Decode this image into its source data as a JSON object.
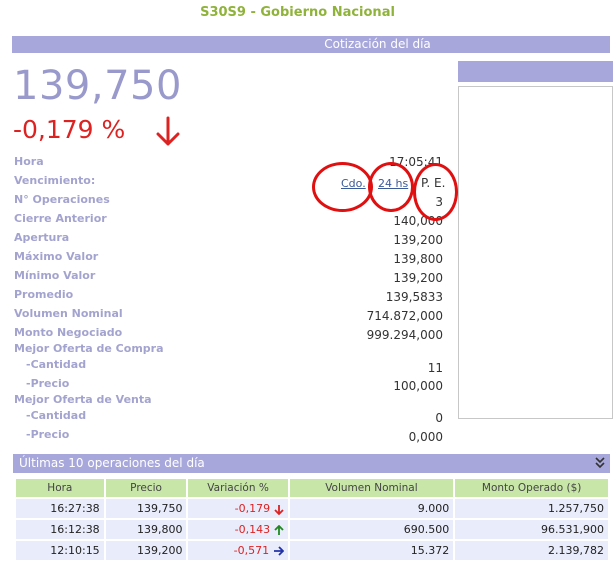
{
  "page_title": "S30S9 - Gobierno Nacional",
  "section_title": "Cotización del día",
  "price": "139,750",
  "variation": "-0,179 %",
  "colors": {
    "accent": "#a7a7db",
    "negative": "#dd2222",
    "positive": "#228822",
    "annotation": "#e01010"
  },
  "info": {
    "hora_label": "Hora",
    "hora_value": "17:05:41",
    "vencimiento_label": "Vencimiento:",
    "venc_cdo": "Cdo.",
    "venc_24": "24 hs",
    "venc_pe": "P. E.",
    "operaciones_label": "N° Operaciones",
    "operaciones_value": "3",
    "cierre_label": "Cierre Anterior",
    "cierre_value": "140,000",
    "apertura_label": "Apertura",
    "apertura_value": "139,200",
    "maximo_label": "Máximo Valor",
    "maximo_value": "139,800",
    "minimo_label": "Mínimo Valor",
    "minimo_value": "139,200",
    "promedio_label": "Promedio",
    "promedio_value": "139,5833",
    "volumen_label": "Volumen Nominal",
    "volumen_value": "714.872,000",
    "monto_label": "Monto Negociado",
    "monto_value": "999.294,000",
    "compra_label": "Mejor Oferta de Compra",
    "compra_cantidad_label": "-Cantidad",
    "compra_cantidad_value": "11",
    "compra_precio_label": "-Precio",
    "compra_precio_value": "100,000",
    "venta_label": "Mejor Oferta de Venta",
    "venta_cantidad_label": "-Cantidad",
    "venta_cantidad_value": "0",
    "venta_precio_label": "-Precio",
    "venta_precio_value": "0,000"
  },
  "ops": {
    "title": "Últimas 10 operaciones del día",
    "headers": [
      "Hora",
      "Precio",
      "Variación %",
      "Volumen Nominal",
      "Monto Operado ($)"
    ],
    "rows": [
      {
        "hora": "16:27:38",
        "precio": "139,750",
        "variacion": "-0,179",
        "trend": "down",
        "volumen": "9.000",
        "monto": "1.257,750"
      },
      {
        "hora": "16:12:38",
        "precio": "139,800",
        "variacion": "-0,143",
        "trend": "up",
        "volumen": "690.500",
        "monto": "96.531,900"
      },
      {
        "hora": "12:10:15",
        "precio": "139,200",
        "variacion": "-0,571",
        "trend": "right",
        "volumen": "15.372",
        "monto": "2.139,782"
      }
    ]
  }
}
